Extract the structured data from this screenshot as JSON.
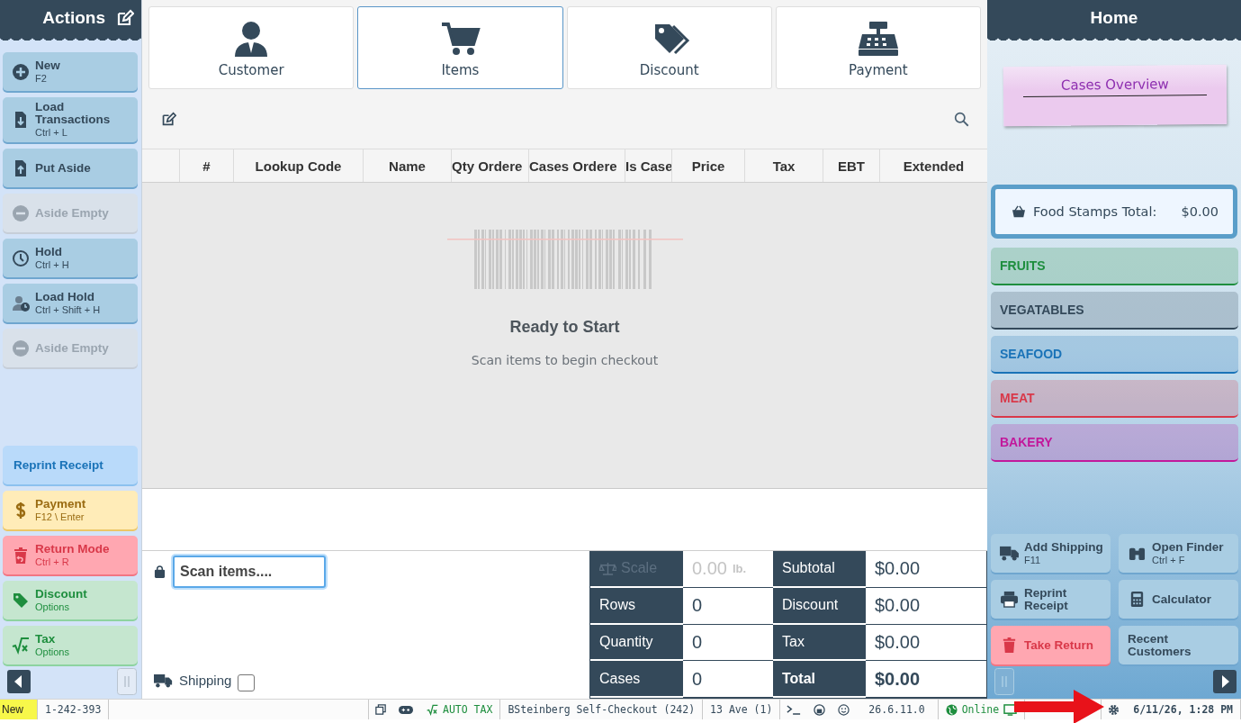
{
  "actions_panel": {
    "title": "Actions",
    "buttons": [
      {
        "label": "New",
        "shortcut": "F2",
        "kind": "primary",
        "disabled": false
      },
      {
        "label": "Load Transactions",
        "shortcut": "Ctrl + L",
        "kind": "primary",
        "disabled": false
      },
      {
        "label": "Put Aside",
        "kind": "primary",
        "disabled": false
      },
      {
        "label": "Aside Empty",
        "kind": "primary",
        "disabled": true
      },
      {
        "label": "Hold",
        "shortcut": "Ctrl + H",
        "kind": "primary",
        "disabled": false
      },
      {
        "label": "Load Hold",
        "shortcut": "Ctrl + Shift + H",
        "kind": "primary",
        "disabled": false
      },
      {
        "label": "Aside Empty",
        "kind": "primary",
        "disabled": true
      }
    ],
    "bottom_buttons": [
      {
        "label": "Reprint Receipt",
        "kind": "info",
        "disabled": false
      },
      {
        "label": "Payment",
        "shortcut": "F12 \\ Enter",
        "kind": "warning",
        "disabled": false
      },
      {
        "label": "Return Mode",
        "shortcut": "Ctrl + R",
        "kind": "danger",
        "disabled": false
      },
      {
        "label": "Discount",
        "shortcut": "Options",
        "kind": "success",
        "disabled": false
      },
      {
        "label": "Tax",
        "shortcut": "Options",
        "kind": "success",
        "disabled": false
      }
    ]
  },
  "tabs": [
    {
      "label": "Customer",
      "selected": false
    },
    {
      "label": "Items",
      "selected": true
    },
    {
      "label": "Discount",
      "selected": false
    },
    {
      "label": "Payment",
      "selected": false
    }
  ],
  "table": {
    "columns": [
      "#",
      "Lookup Code",
      "Name",
      "Qty Ordere",
      "Cases Ordere",
      "Is Case",
      "Price",
      "Tax",
      "EBT",
      "Extended"
    ],
    "empty_title": "Ready to Start",
    "empty_text": "Scan items to begin checkout"
  },
  "scan": {
    "placeholder": "Scan items...."
  },
  "shipping": {
    "label": "Shipping",
    "checked": false
  },
  "summary": [
    {
      "label": "Scale",
      "value": "0.00",
      "unit": "lb.",
      "disabled": true,
      "emphasis": false
    },
    {
      "label": "Subtotal",
      "value": "$0.00",
      "disabled": false,
      "emphasis": false
    },
    {
      "label": "Rows",
      "value": "0",
      "disabled": false,
      "emphasis": false
    },
    {
      "label": "Discount",
      "value": "$0.00",
      "disabled": false,
      "emphasis": false
    },
    {
      "label": "Quantity",
      "value": "0",
      "disabled": false,
      "emphasis": false
    },
    {
      "label": "Tax",
      "value": "$0.00",
      "disabled": false,
      "emphasis": false
    },
    {
      "label": "Cases",
      "value": "0",
      "disabled": false,
      "emphasis": false
    },
    {
      "label": "Total",
      "value": "$0.00",
      "disabled": false,
      "emphasis": true
    }
  ],
  "home_panel": {
    "title": "Home",
    "note": "Cases Overview",
    "food_stamps": {
      "label": "Food Stamps Total:",
      "value": "$0.00"
    },
    "categories": [
      {
        "label": "FRUITS",
        "color": "#1e8e3e"
      },
      {
        "label": "VEGATABLES",
        "color": "#34495a"
      },
      {
        "label": "SEAFOOD",
        "color": "#1a73b8"
      },
      {
        "label": "MEAT",
        "color": "#d93849"
      },
      {
        "label": "BAKERY",
        "color": "#c2189b"
      }
    ],
    "buttons": [
      {
        "label": "Add Shipping",
        "shortcut": "F11",
        "kind": "primary"
      },
      {
        "label": "Open Finder",
        "shortcut": "Ctrl + F",
        "kind": "primary"
      },
      {
        "label": "Reprint Receipt",
        "kind": "primary"
      },
      {
        "label": "Calculator",
        "kind": "primary"
      },
      {
        "label": "Take Return",
        "kind": "danger"
      },
      {
        "label": "Recent Customers",
        "kind": "primary"
      }
    ]
  },
  "status_bar": {
    "mode": "New",
    "transaction": "1-242-393",
    "tax": "AUTO TAX",
    "station": "BSteinberg Self-Checkout (242)",
    "store": "13 Ave (1)",
    "version": "26.6.11.0",
    "connection": "Online",
    "datetime": "6/11/26, 1:28 PM"
  }
}
